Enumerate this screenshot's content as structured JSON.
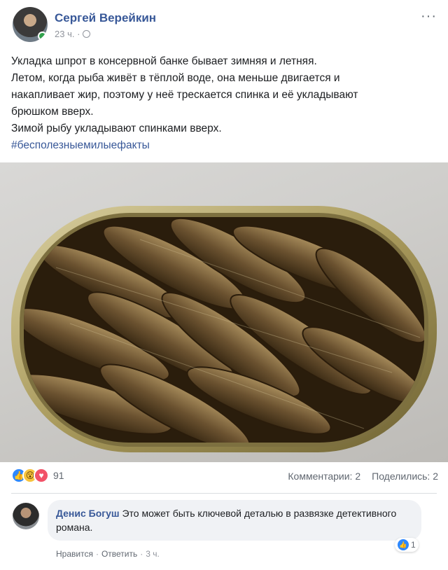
{
  "post": {
    "author": "Сергей Верейкин",
    "time": "23 ч. ·",
    "more_label": "···",
    "text_lines": [
      "Укладка шпрот в консервной банке бывает зимняя и летняя.",
      "Летом, когда рыба живёт в тёплой воде, она меньше двигается и",
      "накапливает жир, поэтому у неё трескается спинка и её укладывают",
      "брюшком вверх.",
      "Зимой рыбу укладывают спинками вверх."
    ],
    "hashtag": "#бесполезныемилыефакты"
  },
  "reactions": {
    "icons": [
      "like-icon",
      "wow-icon",
      "love-icon"
    ],
    "count": "91",
    "comments": "Комментарии: 2",
    "shares": "Поделились: 2"
  },
  "comment": {
    "author": "Денис Богуш",
    "text": "Это может быть ключевой деталью в развязке детективного романа.",
    "likes": "1",
    "like_action": "Нравится",
    "reply_action": "Ответить",
    "time": "3 ч."
  },
  "colors": {
    "link": "#385898",
    "like": "#2d88ff",
    "wow": "#f7c33c",
    "love": "#f25268"
  }
}
